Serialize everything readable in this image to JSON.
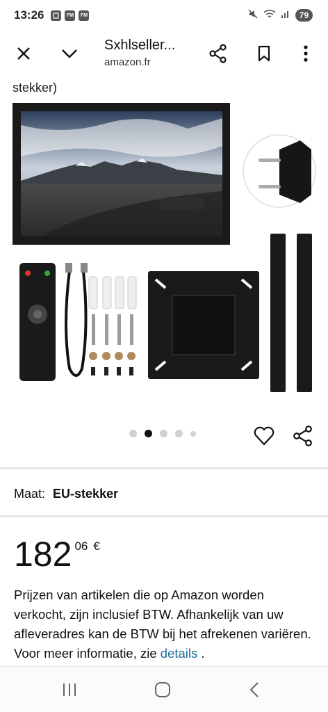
{
  "status_bar": {
    "time": "13:26",
    "notif_icons": [
      "",
      "FM",
      "FM"
    ],
    "battery": "79"
  },
  "toolbar": {
    "title": "Sxhlseller...",
    "domain": "amazon.fr"
  },
  "cut_off_text": "stekker)",
  "gallery": {
    "dots_total": 5,
    "active_dot": 1
  },
  "size": {
    "label": "Maat:",
    "value": "EU-stekker"
  },
  "price": {
    "whole": "182",
    "fraction": "06",
    "currency": "€"
  },
  "vat": {
    "text": "Prijzen van artikelen die op Amazon worden verkocht, zijn inclusief BTW. Afhankelijk van uw afleveradres kan de BTW bij het afrekenen variëren. Voor meer informatie, zie",
    "link": "details",
    "end": "."
  },
  "colors": {
    "link": "#1f6b96",
    "divider": "#e6e6e6"
  }
}
